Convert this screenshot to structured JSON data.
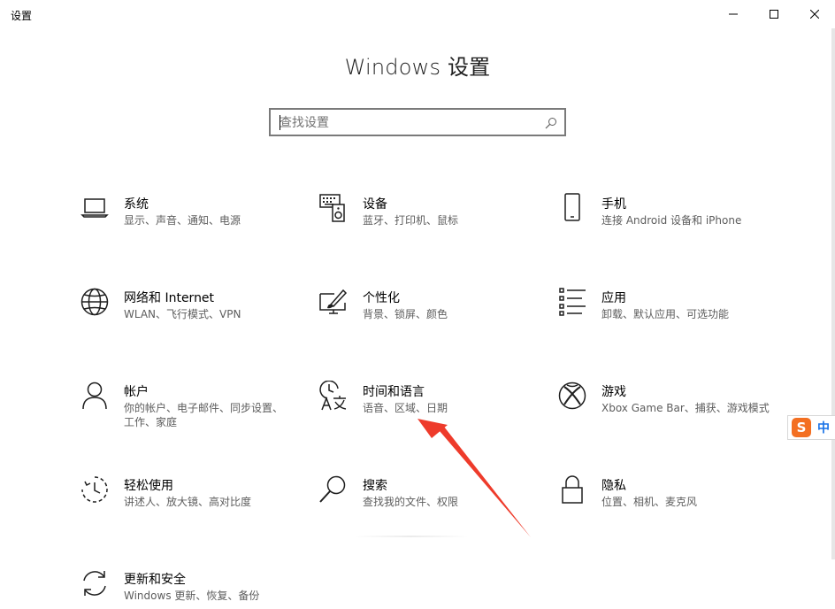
{
  "window": {
    "title": "设置",
    "minimize_icon": "minimize-icon",
    "maximize_icon": "maximize-icon",
    "close_icon": "close-icon"
  },
  "header": {
    "title": "Windows 设置"
  },
  "search": {
    "placeholder": "查找设置",
    "value": "",
    "icon": "search-icon"
  },
  "categories": [
    {
      "title": "系统",
      "desc": "显示、声音、通知、电源",
      "icon": "laptop-icon"
    },
    {
      "title": "设备",
      "desc": "蓝牙、打印机、鼠标",
      "icon": "keyboard-speaker-icon"
    },
    {
      "title": "手机",
      "desc": "连接 Android 设备和 iPhone",
      "icon": "phone-icon"
    },
    {
      "title": "网络和 Internet",
      "desc": "WLAN、飞行模式、VPN",
      "icon": "globe-icon"
    },
    {
      "title": "个性化",
      "desc": "背景、锁屏、颜色",
      "icon": "paint-monitor-icon"
    },
    {
      "title": "应用",
      "desc": "卸载、默认应用、可选功能",
      "icon": "app-list-icon"
    },
    {
      "title": "帐户",
      "desc": "你的帐户、电子邮件、同步设置、工作、家庭",
      "icon": "person-icon"
    },
    {
      "title": "时间和语言",
      "desc": "语音、区域、日期",
      "icon": "time-language-icon"
    },
    {
      "title": "游戏",
      "desc": "Xbox Game Bar、捕获、游戏模式",
      "icon": "xbox-icon"
    },
    {
      "title": "轻松使用",
      "desc": "讲述人、放大镜、高对比度",
      "icon": "ease-of-access-icon"
    },
    {
      "title": "搜索",
      "desc": "查找我的文件、权限",
      "icon": "magnifier-icon"
    },
    {
      "title": "隐私",
      "desc": "位置、相机、麦克风",
      "icon": "lock-icon"
    },
    {
      "title": "更新和安全",
      "desc": "Windows 更新、恢复、备份",
      "icon": "sync-arrows-icon"
    }
  ],
  "ime": {
    "logo": "S",
    "mode": "中"
  },
  "colors": {
    "annotation_arrow": "#ee3b2b",
    "ime_brand": "#f36f21",
    "ime_mode": "#1a73e8"
  }
}
